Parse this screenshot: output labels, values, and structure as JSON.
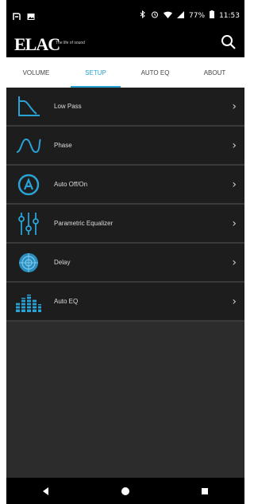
{
  "status_bar": {
    "battery_percent": "77%",
    "time": "11:53",
    "icons": [
      "n-icon",
      "image-icon",
      "bluetooth-icon",
      "alarm-icon",
      "wifi-icon",
      "signal-icon",
      "battery-icon"
    ]
  },
  "app_bar": {
    "logo": "ELAC",
    "tagline": "The life of sound",
    "search_icon": "search-icon"
  },
  "tabs": [
    {
      "label": "VOLUME",
      "active": false
    },
    {
      "label": "SETUP",
      "active": true
    },
    {
      "label": "AUTO EQ",
      "active": false
    },
    {
      "label": "ABOUT",
      "active": false
    }
  ],
  "menu": [
    {
      "label": "Low Pass",
      "icon": "low-pass-icon"
    },
    {
      "label": "Phase",
      "icon": "phase-icon"
    },
    {
      "label": "Auto Off/On",
      "icon": "auto-icon"
    },
    {
      "label": "Parametric Equalizer",
      "icon": "equalizer-icon"
    },
    {
      "label": "Delay",
      "icon": "delay-icon"
    },
    {
      "label": "Auto EQ",
      "icon": "auto-eq-icon"
    }
  ],
  "colors": {
    "accent": "#29a3d6",
    "row_bg": "#1d1d1d",
    "panel_bg": "#2c2c2c"
  },
  "nav": [
    "back-icon",
    "home-icon",
    "recents-icon"
  ]
}
